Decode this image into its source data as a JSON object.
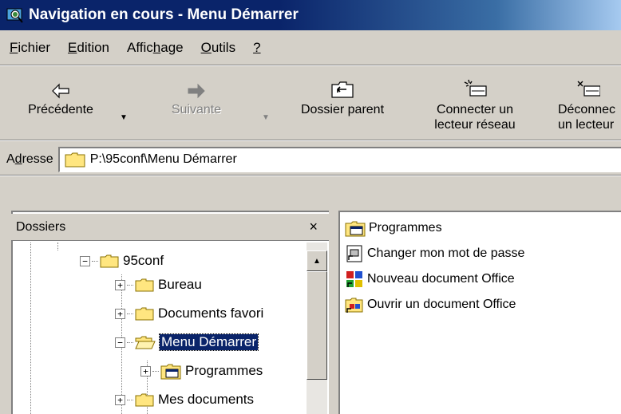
{
  "window": {
    "title": "Navigation en cours - Menu Démarrer"
  },
  "menubar": {
    "items": [
      {
        "mnemonic": "F",
        "rest": "ichier"
      },
      {
        "mnemonic": "E",
        "rest": "dition"
      },
      {
        "pre": "Affic",
        "mnemonic": "h",
        "rest": "age"
      },
      {
        "mnemonic": "O",
        "rest": "utils"
      },
      {
        "mnemonic": "?",
        "rest": ""
      }
    ]
  },
  "toolbar": {
    "back_label": "Précédente",
    "forward_label": "Suivante",
    "up_label": "Dossier parent",
    "map_drive_label_1": "Connecter un",
    "map_drive_label_2": "lecteur réseau",
    "disconnect_label_1": "Déconnec",
    "disconnect_label_2": "un lecteur"
  },
  "address": {
    "label_pre": "A",
    "label_mn": "d",
    "label_rest": "resse",
    "value": "P:\\95conf\\Menu Démarrer"
  },
  "folders_panel": {
    "title": "Dossiers",
    "close_glyph": "×",
    "tree": [
      {
        "label": "95conf",
        "expander": "−"
      },
      {
        "label": "Bureau",
        "expander": "+"
      },
      {
        "label": "Documents favori",
        "expander": "+"
      },
      {
        "label": "Menu Démarrer",
        "expander": "−",
        "selected": true
      },
      {
        "label": "Programmes",
        "expander": "+"
      },
      {
        "label": "Mes documents",
        "expander": "+"
      }
    ]
  },
  "file_list": {
    "items": [
      {
        "label": "Programmes",
        "icon": "program-group-icon"
      },
      {
        "label": "Changer mon mot de passe",
        "icon": "shortcut-icon"
      },
      {
        "label": "Nouveau document Office",
        "icon": "new-office-doc-icon"
      },
      {
        "label": "Ouvrir un document Office",
        "icon": "open-office-doc-icon"
      }
    ]
  },
  "colors": {
    "titlebar": "#0a246a",
    "selection": "#0a246a",
    "face": "#d4d0c8"
  }
}
